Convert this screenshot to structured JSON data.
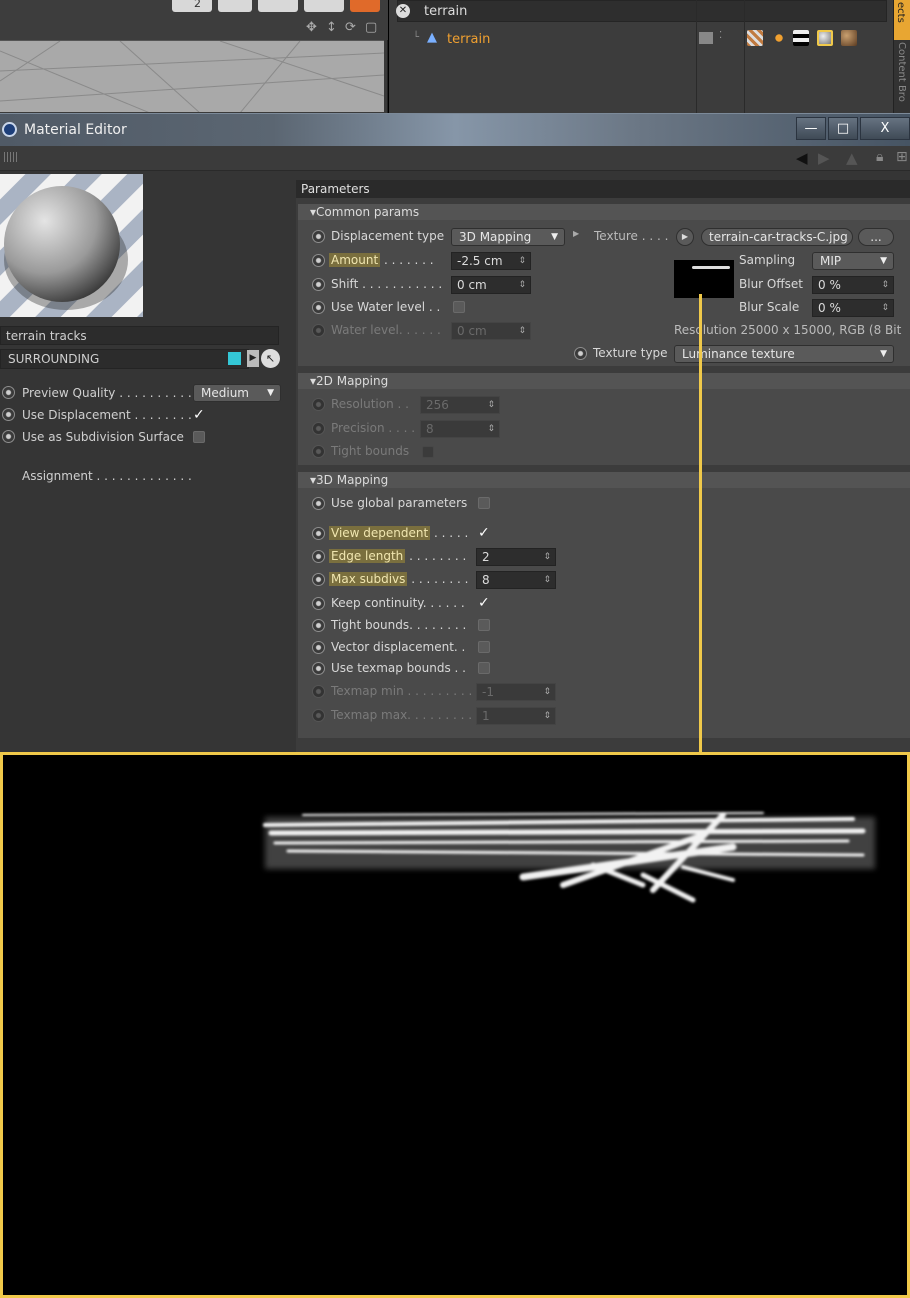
{
  "object_manager": {
    "search_value": "terrain",
    "object_name": "terrain"
  },
  "viewport": {
    "counter": "2"
  },
  "side_tab": {
    "label": "Content Bro",
    "label2": "ects"
  },
  "window": {
    "title": "Material Editor",
    "minimize": "—",
    "maximize": "□",
    "close": "X"
  },
  "material": {
    "name": "terrain tracks",
    "type": "SURROUNDING",
    "preview_quality_label": "Preview Quality . . . . . . . . . .",
    "preview_quality_value": "Medium",
    "use_displacement_label": "Use Displacement . . . . . . . .",
    "use_subdivision_label": "Use as Subdivision Surface",
    "assignment_label": "Assignment . . . . . . . . . . . . ."
  },
  "parameters": {
    "header": "Parameters",
    "common": {
      "title": "Common params",
      "displacement_type_label": "Displacement type",
      "displacement_type_value": "3D Mapping",
      "texture_label": "Texture . . . .",
      "texture_file": "terrain-car-tracks-C.jpg",
      "browse": "...",
      "amount_label": "Amount",
      "amount_dots": " . . . . . . .",
      "amount_value": "-2.5 cm",
      "shift_label": "Shift . . . . . . . . . . .",
      "shift_value": "0 cm",
      "water_label": "Use Water level . .",
      "water_level_label": "Water level. . . . . .",
      "water_level_value": "0 cm",
      "sampling_label": "Sampling",
      "sampling_value": "MIP",
      "blur_offset_label": "Blur Offset",
      "blur_offset_value": "0 %",
      "blur_scale_label": "Blur Scale",
      "blur_scale_value": "0 %",
      "resolution_text": "Resolution 25000 x 15000, RGB (8 Bit",
      "texture_type_label": "Texture type",
      "texture_type_value": "Luminance texture"
    },
    "mapping2d": {
      "title": "2D Mapping",
      "resolution_label": "Resolution . .",
      "resolution_value": "256",
      "precision_label": "Precision . . . .",
      "precision_value": "8",
      "tight_label": "Tight bounds"
    },
    "mapping3d": {
      "title": "3D Mapping",
      "global_label": "Use global parameters",
      "view_dep_label": "View dependent",
      "view_dep_dots": " . . . . .",
      "edge_label": "Edge length",
      "edge_dots": " . . . . . . . .",
      "edge_value": "2",
      "max_label": "Max subdivs",
      "max_dots": " . . . . . . . .",
      "max_value": "8",
      "keep_label": "Keep continuity. . . . . .",
      "tight_label": "Tight bounds. . . . . . . .",
      "vector_label": "Vector displacement. .",
      "texmap_bounds_label": "Use texmap bounds . .",
      "texmap_min_label": "Texmap min . . . . . . . . .",
      "texmap_min_value": "-1",
      "texmap_max_label": "Texmap max. . . . . . . . .",
      "texmap_max_value": "1"
    }
  },
  "colors": {
    "highlight": "#7a6f3e",
    "zoom_border": "#f0c94a",
    "object_name": "#f0a030",
    "type_swatch": "#34c7d6"
  }
}
